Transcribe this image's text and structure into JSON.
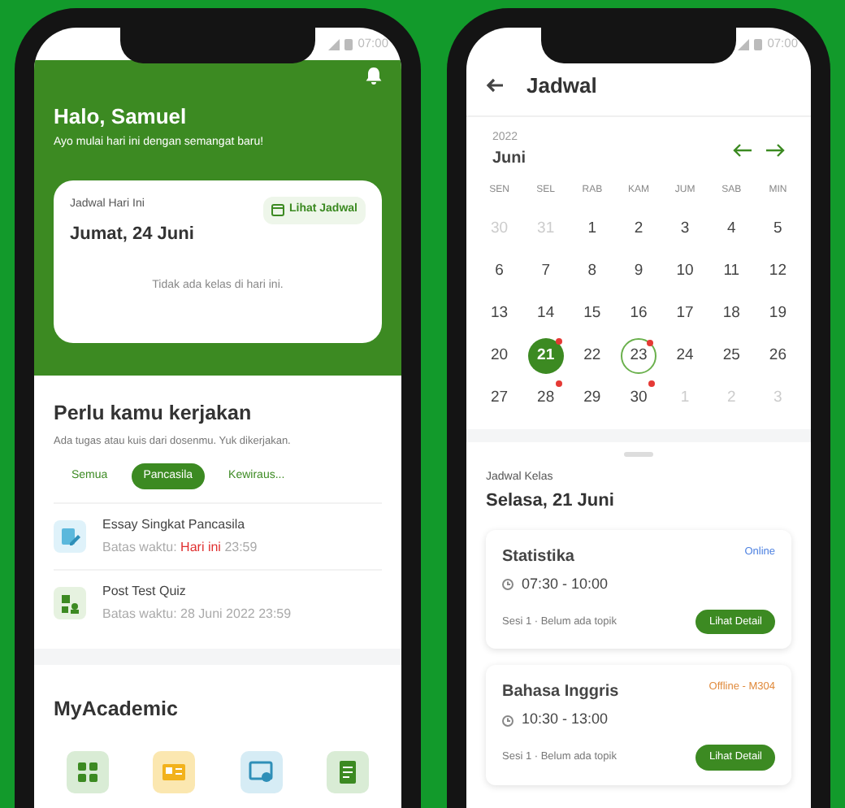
{
  "home_screen": {
    "status_time": "07:00",
    "greeting": "Halo, Samuel",
    "greeting_subtitle": "Ayo mulai hari ini dengan semangat baru!",
    "today_card": {
      "label": "Jadwal Hari Ini",
      "date": "Jumat, 24 Juni",
      "link": "Lihat Jadwal",
      "empty_text": "Tidak ada kelas di hari ini."
    },
    "tasks": {
      "title": "Perlu kamu kerjakan",
      "subtitle": "Ada tugas atau kuis dari dosenmu. Yuk dikerjakan.",
      "filters": [
        {
          "label": "Semua",
          "selected": false
        },
        {
          "label": "Pancasila",
          "selected": true
        },
        {
          "label": "Kewiraus...",
          "selected": false
        }
      ],
      "items": [
        {
          "kind": "essay",
          "title": "Essay Singkat Pancasila",
          "deadline": [
            {
              "text": "Batas waktu:",
              "urgent": false
            },
            {
              "text": "Hari ini",
              "urgent": true
            },
            {
              "text": "23:59",
              "urgent": false
            }
          ]
        },
        {
          "kind": "quiz",
          "title": "Post Test Quiz",
          "deadline": [
            {
              "text": "Batas waktu: 28 Juni 2022 23:59",
              "urgent": false
            }
          ]
        }
      ]
    },
    "academic": {
      "title": "MyAcademic",
      "tiles": [
        {
          "kind": "grid",
          "color": "#d9ecd5"
        },
        {
          "kind": "card",
          "color": "#fbe7b0"
        },
        {
          "kind": "screen",
          "color": "#d6ecf5"
        },
        {
          "kind": "doc",
          "color": "#d9ecd5"
        }
      ]
    }
  },
  "schedule_screen": {
    "status_time": "07:00",
    "title": "Jadwal",
    "year": "2022",
    "month": "Juni",
    "weekdays": [
      "SEN",
      "SEL",
      "RAB",
      "KAM",
      "JUM",
      "SAB",
      "MIN"
    ],
    "days": [
      {
        "label": "30",
        "muted": true,
        "selected": false,
        "today": false,
        "event": false
      },
      {
        "label": "31",
        "muted": true,
        "selected": false,
        "today": false,
        "event": false
      },
      {
        "label": "1",
        "muted": false,
        "selected": false,
        "today": false,
        "event": false
      },
      {
        "label": "2",
        "muted": false,
        "selected": false,
        "today": false,
        "event": false
      },
      {
        "label": "3",
        "muted": false,
        "selected": false,
        "today": false,
        "event": false
      },
      {
        "label": "4",
        "muted": false,
        "selected": false,
        "today": false,
        "event": false
      },
      {
        "label": "5",
        "muted": false,
        "selected": false,
        "today": false,
        "event": false
      },
      {
        "label": "6",
        "muted": false,
        "selected": false,
        "today": false,
        "event": false
      },
      {
        "label": "7",
        "muted": false,
        "selected": false,
        "today": false,
        "event": false
      },
      {
        "label": "8",
        "muted": false,
        "selected": false,
        "today": false,
        "event": false
      },
      {
        "label": "9",
        "muted": false,
        "selected": false,
        "today": false,
        "event": false
      },
      {
        "label": "10",
        "muted": false,
        "selected": false,
        "today": false,
        "event": false
      },
      {
        "label": "11",
        "muted": false,
        "selected": false,
        "today": false,
        "event": false
      },
      {
        "label": "12",
        "muted": false,
        "selected": false,
        "today": false,
        "event": false
      },
      {
        "label": "13",
        "muted": false,
        "selected": false,
        "today": false,
        "event": false
      },
      {
        "label": "14",
        "muted": false,
        "selected": false,
        "today": false,
        "event": false
      },
      {
        "label": "15",
        "muted": false,
        "selected": false,
        "today": false,
        "event": false
      },
      {
        "label": "16",
        "muted": false,
        "selected": false,
        "today": false,
        "event": false
      },
      {
        "label": "17",
        "muted": false,
        "selected": false,
        "today": false,
        "event": false
      },
      {
        "label": "18",
        "muted": false,
        "selected": false,
        "today": false,
        "event": false
      },
      {
        "label": "19",
        "muted": false,
        "selected": false,
        "today": false,
        "event": false
      },
      {
        "label": "20",
        "muted": false,
        "selected": false,
        "today": false,
        "event": false
      },
      {
        "label": "21",
        "muted": false,
        "selected": true,
        "today": false,
        "event": true
      },
      {
        "label": "22",
        "muted": false,
        "selected": false,
        "today": false,
        "event": false
      },
      {
        "label": "23",
        "muted": false,
        "selected": false,
        "today": true,
        "event": true
      },
      {
        "label": "24",
        "muted": false,
        "selected": false,
        "today": false,
        "event": false
      },
      {
        "label": "25",
        "muted": false,
        "selected": false,
        "today": false,
        "event": false
      },
      {
        "label": "26",
        "muted": false,
        "selected": false,
        "today": false,
        "event": false
      },
      {
        "label": "27",
        "muted": false,
        "selected": false,
        "today": false,
        "event": false
      },
      {
        "label": "28",
        "muted": false,
        "selected": false,
        "today": false,
        "event": true
      },
      {
        "label": "29",
        "muted": false,
        "selected": false,
        "today": false,
        "event": false
      },
      {
        "label": "30",
        "muted": false,
        "selected": false,
        "today": false,
        "event": true
      },
      {
        "label": "1",
        "muted": true,
        "selected": false,
        "today": false,
        "event": false
      },
      {
        "label": "2",
        "muted": true,
        "selected": false,
        "today": false,
        "event": false
      },
      {
        "label": "3",
        "muted": true,
        "selected": false,
        "today": false,
        "event": false
      }
    ],
    "sheet_label": "Jadwal Kelas",
    "sheet_date": "Selasa, 21 Juni",
    "classes": [
      {
        "name": "Statistika",
        "mode": "Online",
        "color": "#4a7fe0",
        "time": "07:30 - 10:00",
        "session": "Sesi 1 · Belum ada topik",
        "button": "Lihat Detail"
      },
      {
        "name": "Bahasa Inggris",
        "mode": "Offline - M304",
        "color": "#e08a3c",
        "time": "10:30 - 13:00",
        "session": "Sesi 1 · Belum ada topik",
        "button": "Lihat Detail"
      }
    ]
  }
}
